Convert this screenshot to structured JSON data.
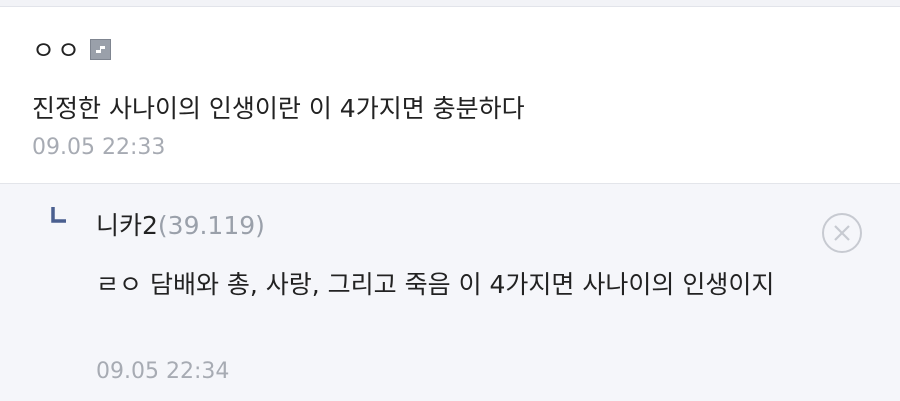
{
  "comment": {
    "nickname": "ㅇㅇ",
    "badge_icon": "fixed-nick-icon",
    "text": "진정한 사나이의 인생이란 이 4가지면 충분하다",
    "date": "09.05 22:33"
  },
  "reply": {
    "arrow_icon": "reply-arrow-icon",
    "nickname": "니카2",
    "ip": "(39.119)",
    "text": "ㄹㅇ 담배와 총, 사랑, 그리고 죽음 이 4가지면 사나이의 인생이지",
    "date": "09.05 22:34",
    "delete_icon": "close-circle-icon"
  },
  "colors": {
    "reply_background": "#f5f6fa",
    "date_gray": "#a7abb3",
    "arrow_blue": "#4a5f8f"
  }
}
